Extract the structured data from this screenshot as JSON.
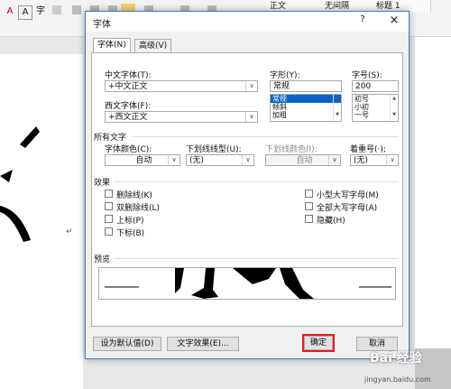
{
  "ribbon": {
    "buttons": [
      "A",
      "A",
      "字"
    ],
    "styles": [
      "正文",
      "无间隔",
      "标题 1"
    ]
  },
  "dialog": {
    "title": "字体",
    "help": "?",
    "close": "×",
    "tabs": [
      {
        "label": "字体(N)",
        "active": true
      },
      {
        "label": "高级(V)",
        "active": false
      }
    ],
    "chinese_font": {
      "label": "中文字体(T):",
      "value": "+中文正文"
    },
    "western_font": {
      "label": "西文字体(F):",
      "value": "+西文正文"
    },
    "style": {
      "label": "字形(Y):",
      "value": "常规",
      "options": [
        "常规",
        "倾斜",
        "加粗"
      ],
      "selected": "常规"
    },
    "size": {
      "label": "字号(S):",
      "value": "200",
      "options": [
        "初号",
        "小初",
        "一号"
      ]
    },
    "all_text_heading": "所有文字",
    "font_color": {
      "label": "字体颜色(C):",
      "value": "自动"
    },
    "underline_type": {
      "label": "下划线线型(U):",
      "value": "(无)"
    },
    "underline_color": {
      "label": "下划线颜色(I):",
      "value": "自动"
    },
    "emphasis": {
      "label": "着重号(·);",
      "value": "(无)"
    },
    "effects_heading": "效果",
    "effects": {
      "strikethrough": "删除线(K)",
      "double_strikethrough": "双删除线(L)",
      "superscript": "上标(P)",
      "subscript": "下标(B)",
      "small_caps": "小型大写字母(M)",
      "all_caps": "全部大写字母(A)",
      "hidden": "隐藏(H)"
    },
    "preview_heading": "预览",
    "buttons": {
      "set_default": "设为默认值(D)",
      "text_effects": "文字效果(E)...",
      "ok": "确定",
      "cancel": "取消"
    }
  },
  "watermark": {
    "brand": "Bai 经验",
    "url": "jingyan.baidu.com"
  }
}
